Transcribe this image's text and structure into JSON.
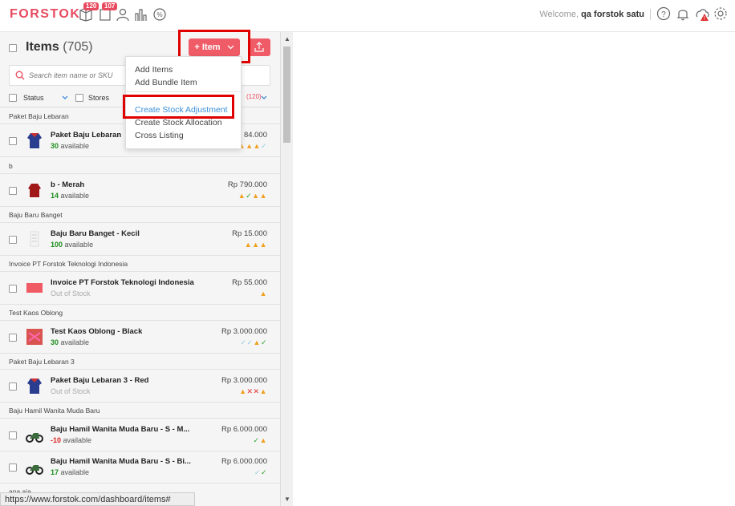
{
  "brand": {
    "logo": "FORSTOK",
    "accent": "#ef5b67"
  },
  "nav": {
    "badges": [
      "120",
      "107"
    ]
  },
  "user": {
    "welcome": "Welcome, ",
    "name": "qa forstok satu"
  },
  "items": {
    "title": "Items",
    "count": "(705)"
  },
  "toolbar": {
    "item_button": "+ Item"
  },
  "search": {
    "placeholder": "Search item name or SKU"
  },
  "filters": {
    "status": "Status",
    "stores": "Stores",
    "count": "(120)"
  },
  "menu": {
    "add_items": "Add Items",
    "add_bundle": "Add Bundle Item",
    "create_stock_adjustment": "Create Stock Adjustment",
    "create_stock_allocation": "Create Stock Allocation",
    "cross_listing": "Cross Listing"
  },
  "rows": [
    {
      "group": "Paket Baju Lebaran",
      "name": "Paket Baju Lebaran",
      "qty": "30",
      "avail": "available",
      "price": "84.000"
    },
    {
      "group": "b",
      "name": "b - Merah",
      "qty": "14",
      "avail": "available",
      "price": "Rp 790.000"
    },
    {
      "group": "Baju Baru Banget",
      "name": "Baju Baru Banget - Kecil",
      "qty": "100",
      "avail": "available",
      "price": "Rp 15.000"
    },
    {
      "group": "Invoice PT Forstok Teknologi Indonesia",
      "name": "Invoice PT Forstok Teknologi Indonesia",
      "qty": "",
      "avail": "Out of Stock",
      "price": "Rp 55.000"
    },
    {
      "group": "Test Kaos Oblong",
      "name": "Test Kaos Oblong - Black",
      "qty": "30",
      "avail": "available",
      "price": "Rp 3.000.000"
    },
    {
      "group": "Paket Baju Lebaran 3",
      "name": "Paket Baju Lebaran 3 - Red",
      "qty": "",
      "avail": "Out of Stock",
      "price": "Rp 3.000.000"
    },
    {
      "group": "Baju Hamil Wanita Muda Baru",
      "name": "Baju Hamil Wanita Muda Baru - S - M...",
      "qty": "-10",
      "avail": "available",
      "price": "Rp 6.000.000"
    },
    {
      "group": "",
      "name": "Baju Hamil Wanita Muda Baru - S - Bi...",
      "qty": "17",
      "avail": "available",
      "price": "Rp 6.000.000"
    },
    {
      "group": "apa aja",
      "name": "",
      "qty": "",
      "avail": "",
      "price": ""
    }
  ],
  "statusbar": {
    "url": "https://www.forstok.com/dashboard/items#"
  }
}
